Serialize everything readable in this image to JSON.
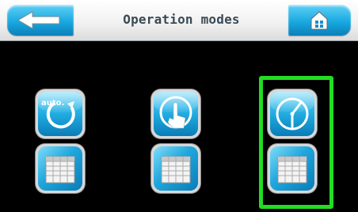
{
  "header": {
    "title": "Operation modes",
    "back_icon": "back-arrow-icon",
    "home_icon": "home-icon",
    "accent": "#19a9e0"
  },
  "modes": [
    {
      "icon": "auto-mode-icon",
      "label_text": "auto.",
      "table_icon": "table-icon"
    },
    {
      "icon": "manual-mode-icon",
      "table_icon": "table-icon"
    },
    {
      "icon": "timer-mode-icon",
      "table_icon": "table-icon",
      "selected": true
    }
  ],
  "selection_color": "#22dd22"
}
